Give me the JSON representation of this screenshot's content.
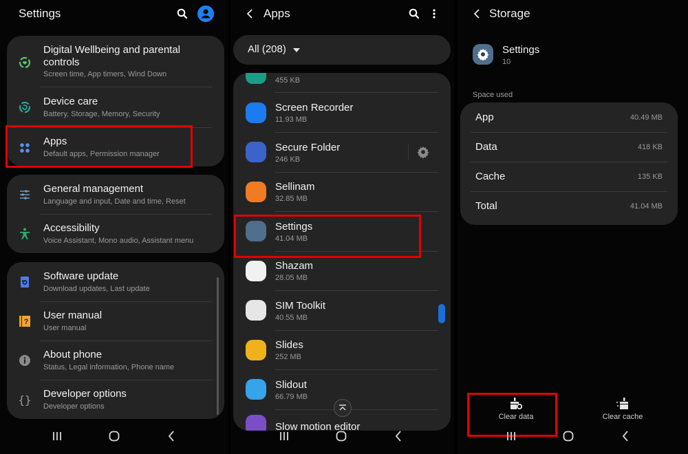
{
  "panel_settings": {
    "title": "Settings",
    "groups": [
      {
        "items": [
          {
            "icon": "digital-wellbeing-icon",
            "title": "Digital Wellbeing and parental controls",
            "title_line1": "Digital Wellbeing and parental",
            "title_line2": "controls",
            "subtitle": "Screen time, App timers, Wind Down"
          },
          {
            "icon": "device-care-icon",
            "title": "Device care",
            "subtitle": "Battery, Storage, Memory, Security"
          },
          {
            "icon": "apps-icon",
            "title": "Apps",
            "subtitle": "Default apps, Permission manager",
            "highlighted": true
          }
        ]
      },
      {
        "items": [
          {
            "icon": "general-management-icon",
            "title": "General management",
            "subtitle": "Language and input, Date and time, Reset"
          },
          {
            "icon": "accessibility-icon",
            "title": "Accessibility",
            "subtitle": "Voice Assistant, Mono audio, Assistant menu"
          }
        ]
      },
      {
        "items": [
          {
            "icon": "software-update-icon",
            "title": "Software update",
            "subtitle": "Download updates, Last update"
          },
          {
            "icon": "user-manual-icon",
            "title": "User manual",
            "subtitle": "User manual"
          },
          {
            "icon": "info-icon",
            "title": "About phone",
            "subtitle": "Status, Legal information, Phone name"
          },
          {
            "icon": "developer-options-icon",
            "title": "Developer options",
            "subtitle": "Developer options"
          }
        ]
      }
    ]
  },
  "panel_apps": {
    "title": "Apps",
    "filter": "All (208)",
    "partial_top_size": "455 KB",
    "apps": [
      {
        "name": "Screen Recorder",
        "size": "11.93 MB",
        "icon_color": "#1a7cf0"
      },
      {
        "name": "Secure Folder",
        "size": "246 KB",
        "icon_color": "#3b63c9",
        "has_settings": true
      },
      {
        "name": "Sellinam",
        "size": "32.85 MB",
        "icon_color": "#ef7b22"
      },
      {
        "name": "Settings",
        "size": "41.04 MB",
        "icon_color": "#4f6f8c",
        "highlighted": true
      },
      {
        "name": "Shazam",
        "size": "28.05 MB",
        "icon_color": "#f1f1f1"
      },
      {
        "name": "SIM Toolkit",
        "size": "40.55 MB",
        "icon_color": "#e6e6e6"
      },
      {
        "name": "Slides",
        "size": "252 MB",
        "icon_color": "#f0b21a"
      },
      {
        "name": "Slidout",
        "size": "66.79 MB",
        "icon_color": "#35a4e8"
      }
    ],
    "partial_bottom_name": "Slow motion editor"
  },
  "panel_storage": {
    "title": "Storage",
    "app_name": "Settings",
    "app_version": "10",
    "section_label": "Space used",
    "rows": [
      {
        "label": "App",
        "value": "40.49 MB"
      },
      {
        "label": "Data",
        "value": "418 KB"
      },
      {
        "label": "Cache",
        "value": "135 KB"
      },
      {
        "label": "Total",
        "value": "41.04 MB"
      }
    ],
    "actions": [
      {
        "label": "Clear data",
        "highlighted": true
      },
      {
        "label": "Clear cache"
      }
    ]
  },
  "colors": {
    "highlight": "#e10000",
    "accent": "#1a7cf0",
    "card": "#242424"
  }
}
